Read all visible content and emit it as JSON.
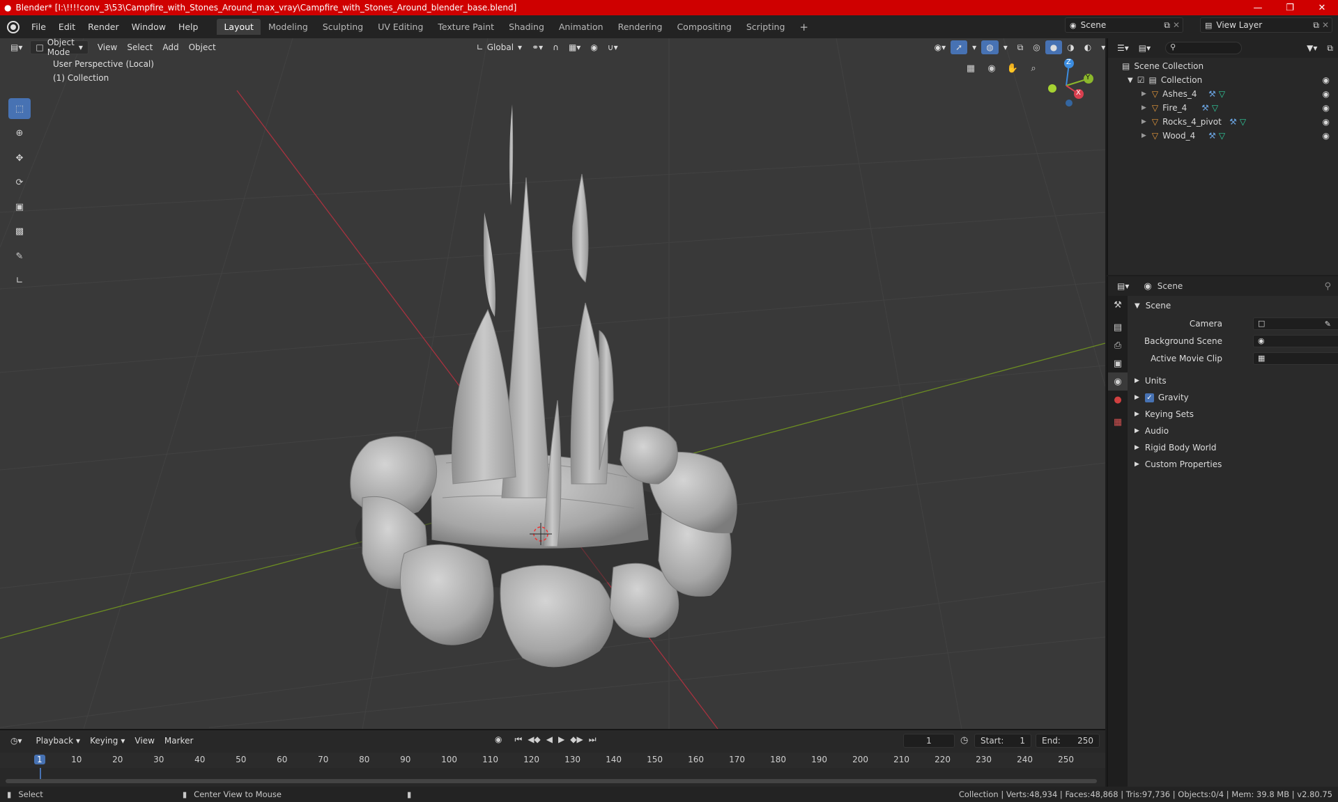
{
  "window": {
    "title": "Blender* [I:\\!!!!conv_3\\53\\Campfire_with_Stones_Around_max_vray\\Campfire_with_Stones_Around_blender_base.blend]",
    "minimize": "—",
    "maximize": "❐",
    "close": "✕"
  },
  "menu": [
    "File",
    "Edit",
    "Render",
    "Window",
    "Help"
  ],
  "workspaces": [
    "Layout",
    "Modeling",
    "Sculpting",
    "UV Editing",
    "Texture Paint",
    "Shading",
    "Animation",
    "Rendering",
    "Compositing",
    "Scripting"
  ],
  "workspace_add": "+",
  "scene_selector": "Scene",
  "view_layer": "View Layer",
  "viewport": {
    "mode": "Object Mode",
    "menus": [
      "View",
      "Select",
      "Add",
      "Object"
    ],
    "transform": "Global",
    "overlay_line1": "User Perspective (Local)",
    "overlay_line2": "(1) Collection",
    "gizmo": {
      "z": "Z",
      "y": "Y",
      "x": "X"
    }
  },
  "outliner": {
    "root": "Scene Collection",
    "collection": "Collection",
    "objects": [
      "Ashes_4",
      "Fire_4",
      "Rocks_4_pivot",
      "Wood_4"
    ]
  },
  "properties": {
    "context": "Scene",
    "panel": "Scene",
    "fields": [
      {
        "label": "Camera"
      },
      {
        "label": "Background Scene"
      },
      {
        "label": "Active Movie Clip"
      }
    ],
    "sections": [
      "Units",
      "Gravity",
      "Keying Sets",
      "Audio",
      "Rigid Body World",
      "Custom Properties"
    ]
  },
  "timeline": {
    "menus": [
      "Playback",
      "Keying",
      "View",
      "Marker"
    ],
    "current_frame": "1",
    "start_label": "Start:",
    "start": "1",
    "end_label": "End:",
    "end": "250",
    "ruler": [
      "1",
      "10",
      "20",
      "30",
      "40",
      "50",
      "60",
      "70",
      "80",
      "90",
      "100",
      "110",
      "120",
      "130",
      "140",
      "150",
      "160",
      "170",
      "180",
      "190",
      "200",
      "210",
      "220",
      "230",
      "240",
      "250"
    ]
  },
  "status": {
    "left1": "Select",
    "left2": "Center View to Mouse",
    "stats": "Collection | Verts:48,934 | Faces:48,868 | Tris:97,736 | Objects:0/4 | Mem: 39.8 MB | v2.80.75"
  },
  "colors": {
    "titlebar": "#cf0000",
    "accent": "#4772b3",
    "x_axis": "#d9404f",
    "y_axis": "#8cb82c",
    "z_axis": "#3c8de0"
  }
}
